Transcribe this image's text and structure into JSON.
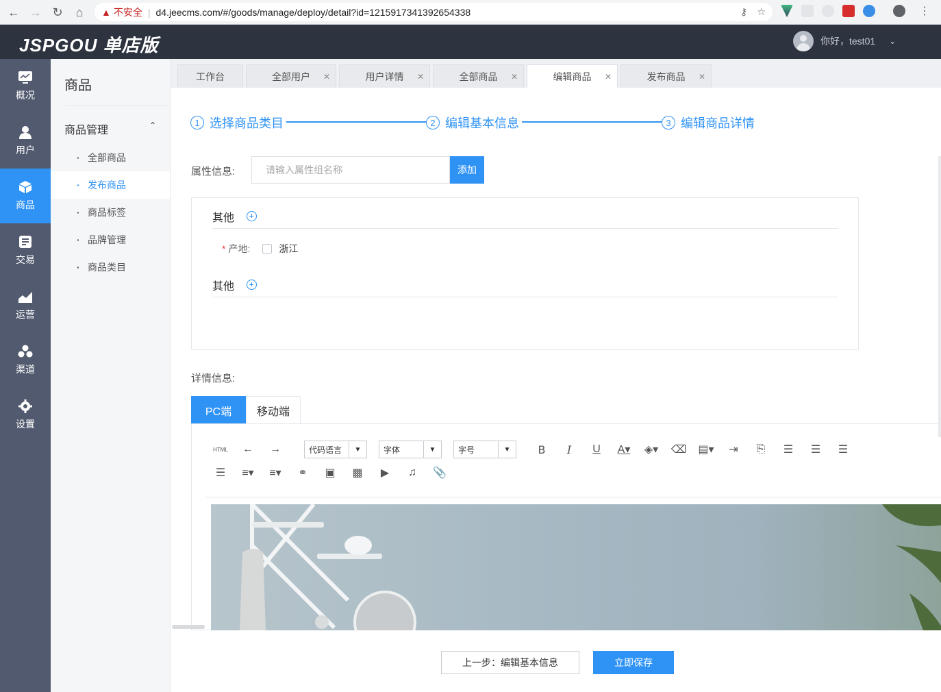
{
  "browser": {
    "insecure_label": "不安全",
    "url": "d4.jeecms.com/#/goods/manage/deploy/detail?id=1215917341392654338"
  },
  "app": {
    "logo": "JSPGOU 单店版",
    "greeting": "你好，test01"
  },
  "side_nav": {
    "items": [
      {
        "label": "概况",
        "icon": "monitor-icon"
      },
      {
        "label": "用户",
        "icon": "user-icon"
      },
      {
        "label": "商品",
        "icon": "cube-icon"
      },
      {
        "label": "交易",
        "icon": "document-icon"
      },
      {
        "label": "运营",
        "icon": "chart-icon"
      },
      {
        "label": "渠道",
        "icon": "cluster-icon"
      },
      {
        "label": "设置",
        "icon": "gear-icon"
      }
    ],
    "active_index": 2
  },
  "sub_nav": {
    "title": "商品",
    "group": "商品管理",
    "items": [
      "全部商品",
      "发布商品",
      "商品标签",
      "品牌管理",
      "商品类目"
    ],
    "active_index": 1
  },
  "tabs": [
    "工作台",
    "全部用户",
    "用户详情",
    "全部商品",
    "编辑商品",
    "发布商品"
  ],
  "active_tab_index": 4,
  "steps": [
    {
      "num": "1",
      "label": "选择商品类目"
    },
    {
      "num": "2",
      "label": "编辑基本信息"
    },
    {
      "num": "3",
      "label": "编辑商品详情"
    }
  ],
  "attr": {
    "label": "属性信息:",
    "placeholder": "请输入属性组名称",
    "add_label": "添加",
    "groups": [
      {
        "name": "其他"
      },
      {
        "name": "其他"
      }
    ],
    "origin_label": "产地:",
    "origin_option": "浙江"
  },
  "detail": {
    "label": "详情信息:",
    "tabs": [
      "PC端",
      "移动端"
    ],
    "active_tab": 0,
    "toolbar": {
      "html_label": "HTML",
      "code_lang": "代码语言",
      "font": "字体",
      "font_size": "字号"
    }
  },
  "footer": {
    "prev_label": "上一步：编辑基本信息",
    "save_label": "立即保存"
  },
  "colors": {
    "primary": "#2f93f5",
    "header_bg": "#2d3440",
    "sidebar_bg": "#515a6e"
  }
}
